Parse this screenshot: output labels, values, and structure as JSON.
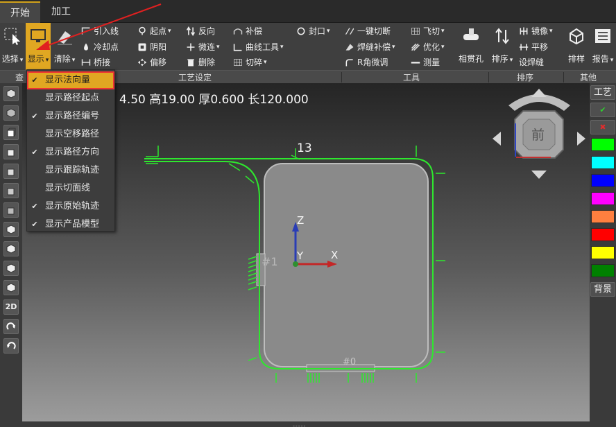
{
  "tabs": [
    {
      "label": "开始"
    },
    {
      "label": "加工"
    }
  ],
  "ribbon": {
    "select": "选择",
    "display": "显示",
    "clear": "清除",
    "lead_in": "引入线",
    "cool_point": "冷却点",
    "bridge": "桥接",
    "start_point": "起点",
    "yin_yang": "阴阳",
    "offset": "偏移",
    "reverse": "反向",
    "micro_link": "微连",
    "delete": "删除",
    "compensate": "补偿",
    "curve_tools": "曲线工具",
    "cut_fragment": "切碎",
    "seal": "封口",
    "one_key_cut": "一键切断",
    "weld_comp": "焊缝补偿",
    "r_corner": "R角微调",
    "fly_cut": "飞切",
    "optimize": "优化",
    "measure": "测量",
    "intersect_hole": "相贯孔",
    "sort": "排序",
    "mirror": "镜像",
    "translate": "平移",
    "set_weld": "设焊缝",
    "nesting": "排样",
    "report": "报告"
  },
  "groups": {
    "view": "查",
    "process": "工艺设定",
    "tools": "工具",
    "sort": "排序",
    "other": "其他"
  },
  "viewport": {
    "dims": "4.50 高19.00 厚0.600 长120.000",
    "view_cube": "前",
    "path_number": "13",
    "path_label": "#1",
    "bottom_label": "#0"
  },
  "axes": {
    "x": "X",
    "y": "Y",
    "z": "Z"
  },
  "left_toolbar": {
    "view_2d": "2D"
  },
  "right_bar": {
    "process": "工艺",
    "confirm": "✔",
    "cancel": "✖",
    "background": "背景",
    "swatches": [
      "#00ff00",
      "#00ffff",
      "#0000ff",
      "#ff00ff",
      "#ff7f3f",
      "#ff0000",
      "#ffff00",
      "#008000"
    ]
  },
  "display_menu": {
    "items": [
      {
        "label": "显示法向量",
        "checked": "✔"
      },
      {
        "label": "显示路径起点",
        "checked": ""
      },
      {
        "label": "显示路径编号",
        "checked": "✔"
      },
      {
        "label": "显示空移路径",
        "checked": ""
      },
      {
        "label": "显示路径方向",
        "checked": "✔"
      },
      {
        "label": "显示跟踪轨迹",
        "checked": ""
      },
      {
        "label": "显示切面线",
        "checked": ""
      },
      {
        "label": "显示原始轨迹",
        "checked": "✔"
      },
      {
        "label": "显示产品模型",
        "checked": "✔"
      }
    ]
  }
}
